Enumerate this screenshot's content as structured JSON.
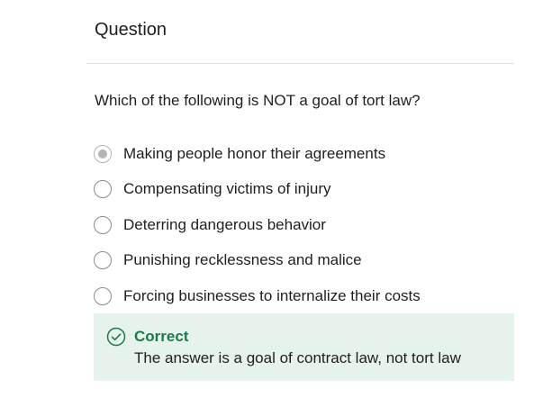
{
  "question": {
    "title": "Question",
    "prompt": "Which of the following is NOT a goal of tort law?",
    "selected_index": 0,
    "options": [
      {
        "label": "Making people honor their agreements"
      },
      {
        "label": "Compensating victims of injury"
      },
      {
        "label": "Deterring dangerous behavior"
      },
      {
        "label": "Punishing recklessness and malice"
      },
      {
        "label": "Forcing businesses to internalize their costs"
      }
    ]
  },
  "feedback": {
    "status": "Correct",
    "explanation": "The answer is a goal of contract law, not tort law",
    "icon": "check-circle-icon",
    "accent_color": "#1e7a4a",
    "background_color": "#e6f2ec"
  }
}
